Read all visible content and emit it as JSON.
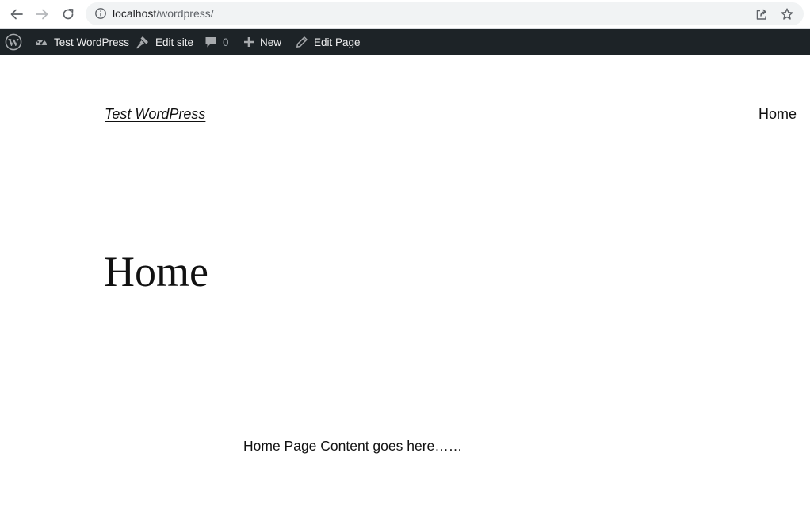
{
  "browser": {
    "url_host": "localhost",
    "url_path": "/wordpress/",
    "icons": {
      "back": "arrow-left-icon",
      "forward": "arrow-right-icon",
      "reload": "reload-icon",
      "site_info": "info-icon",
      "share": "share-icon",
      "bookmark": "star-icon"
    }
  },
  "admin_bar": {
    "background": "#1d2327",
    "site_name": "Test WordPress",
    "edit_site": "Edit site",
    "comments_count": "0",
    "new_label": "New",
    "edit_page": "Edit Page"
  },
  "site": {
    "title": "Test WordPress",
    "nav": [
      {
        "label": "Home"
      }
    ]
  },
  "page": {
    "heading": "Home",
    "content": "Home Page Content goes here……"
  }
}
